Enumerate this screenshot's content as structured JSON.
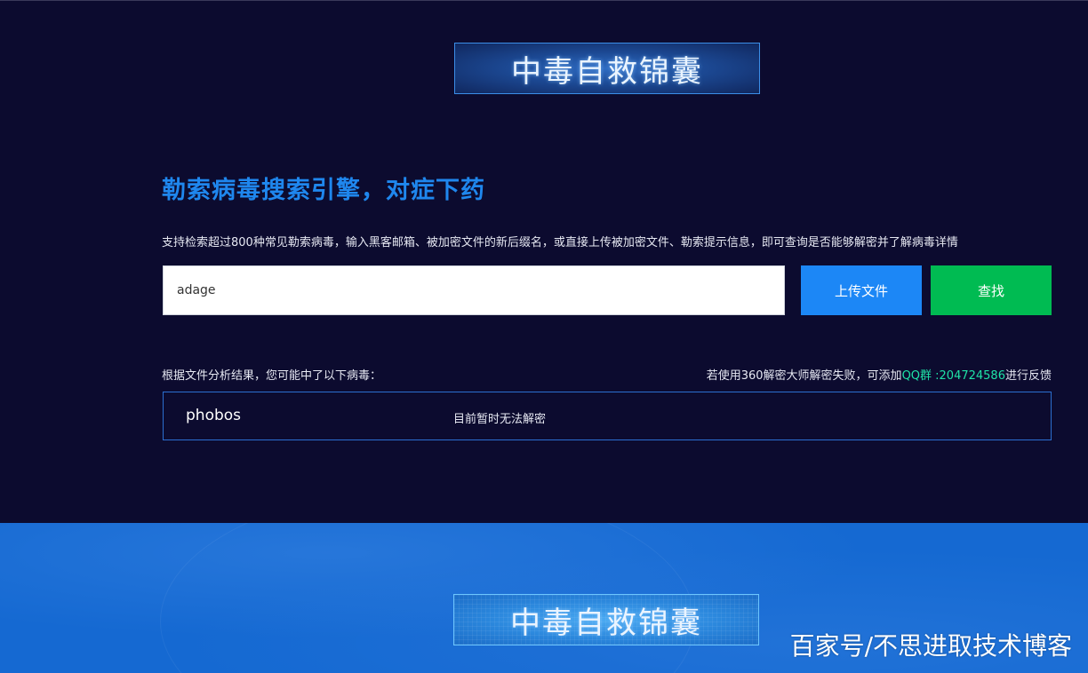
{
  "banner": {
    "title": "中毒自救锦囊"
  },
  "search": {
    "headline": "勒索病毒搜索引擎，对症下药",
    "description": "支持检索超过800种常见勒索病毒，输入黑客邮箱、被加密文件的新后缀名，或直接上传被加密文件、勒索提示信息，即可查询是否能够解密并了解病毒详情",
    "input_value": "adage",
    "upload_label": "上传文件",
    "find_label": "查找"
  },
  "results": {
    "label": "根据文件分析结果，您可能中了以下病毒：",
    "feedback_prefix": "若使用360解密大师解密失败，可添加",
    "feedback_qq": "QQ群 :204724586",
    "feedback_suffix": "进行反馈",
    "items": [
      {
        "name": "phobos",
        "status": "目前暂时无法解密"
      }
    ]
  },
  "footer": {
    "banner_title": "中毒自救锦囊",
    "watermark": "百家号/不思进取技术博客"
  },
  "colors": {
    "background": "#0c0b2f",
    "headline": "#1f87ee",
    "upload": "#1c87f6",
    "find": "#00bb52",
    "qq": "#1fe3a7",
    "bottom": "#1569d2"
  }
}
